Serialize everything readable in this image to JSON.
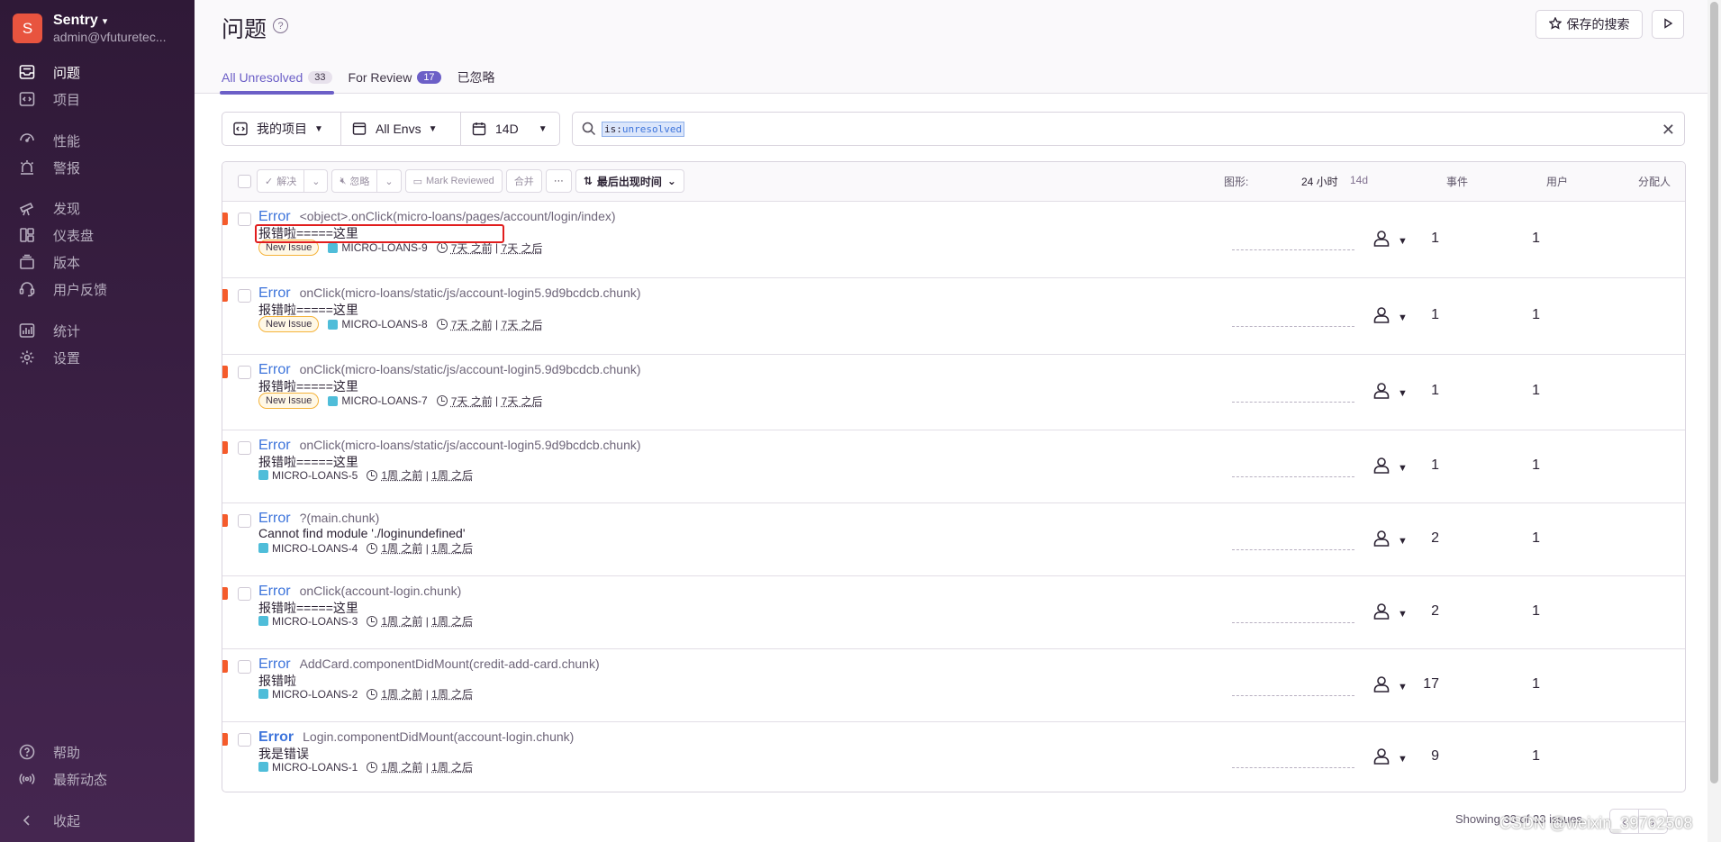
{
  "sidebar": {
    "org_initial": "S",
    "org_name": "Sentry",
    "org_email": "admin@vfuturetec...",
    "items": [
      {
        "label": "问题",
        "icon": "inbox-icon",
        "active": true
      },
      {
        "label": "项目",
        "icon": "code-icon"
      },
      {
        "label": "性能",
        "icon": "lightning-icon"
      },
      {
        "label": "警报",
        "icon": "siren-icon"
      },
      {
        "label": "发现",
        "icon": "telescope-icon"
      },
      {
        "label": "仪表盘",
        "icon": "dashboard-icon"
      },
      {
        "label": "版本",
        "icon": "releases-icon"
      },
      {
        "label": "用户反馈",
        "icon": "support-icon"
      },
      {
        "label": "统计",
        "icon": "stats-icon"
      },
      {
        "label": "设置",
        "icon": "settings-icon"
      }
    ],
    "bottom": [
      {
        "label": "帮助",
        "icon": "question-icon"
      },
      {
        "label": "最新动态",
        "icon": "broadcast-icon"
      },
      {
        "label": "收起",
        "icon": "collapse-icon"
      }
    ]
  },
  "header": {
    "title": "问题",
    "saved_search_label": "保存的搜索"
  },
  "tabs": [
    {
      "label": "All Unresolved",
      "count": "33",
      "active": true
    },
    {
      "label": "For Review",
      "count": "17"
    },
    {
      "label": "已忽略",
      "count": null
    }
  ],
  "filters": {
    "project": "我的项目",
    "env": "All Envs",
    "period": "14D"
  },
  "search": {
    "token_key": "is:",
    "token_value": "unresolved"
  },
  "toolbar": {
    "resolve": "解决",
    "ignore": "忽略",
    "mark_reviewed": "Mark Reviewed",
    "merge": "合并",
    "more": "···",
    "sort": "最后出现时间"
  },
  "columns": {
    "graph": "图形:",
    "period_24h": "24 小时",
    "period_14d": "14d",
    "events": "事件",
    "users": "用户",
    "assignee": "分配人"
  },
  "issues": [
    {
      "type": "Error",
      "location": "<object>.onClick(micro-loans/pages/account/login/index)",
      "message": "报错啦=====这里",
      "new": true,
      "project": "MICRO-LOANS-9",
      "first": "7天 之前",
      "last": "7天 之后",
      "events": "1",
      "users": "1"
    },
    {
      "type": "Error",
      "location": "onClick(micro-loans/static/js/account-login5.9d9bcdcb.chunk)",
      "message": "报错啦=====这里",
      "new": true,
      "project": "MICRO-LOANS-8",
      "first": "7天 之前",
      "last": "7天 之后",
      "events": "1",
      "users": "1"
    },
    {
      "type": "Error",
      "location": "onClick(micro-loans/static/js/account-login5.9d9bcdcb.chunk)",
      "message": "报错啦=====这里",
      "new": true,
      "project": "MICRO-LOANS-7",
      "first": "7天 之前",
      "last": "7天 之后",
      "events": "1",
      "users": "1"
    },
    {
      "type": "Error",
      "location": "onClick(micro-loans/static/js/account-login5.9d9bcdcb.chunk)",
      "message": "报错啦=====这里",
      "new": false,
      "project": "MICRO-LOANS-5",
      "first": "1周 之前",
      "last": "1周 之后",
      "events": "1",
      "users": "1"
    },
    {
      "type": "Error",
      "location": "?(main.chunk)",
      "message": "Cannot find module './loginundefined'",
      "new": false,
      "project": "MICRO-LOANS-4",
      "first": "1周 之前",
      "last": "1周 之后",
      "events": "2",
      "users": "1"
    },
    {
      "type": "Error",
      "location": "onClick(account-login.chunk)",
      "message": "报错啦=====这里",
      "new": false,
      "project": "MICRO-LOANS-3",
      "first": "1周 之前",
      "last": "1周 之后",
      "events": "2",
      "users": "1"
    },
    {
      "type": "Error",
      "location": "AddCard.componentDidMount(credit-add-card.chunk)",
      "message": "报错啦",
      "new": false,
      "project": "MICRO-LOANS-2",
      "first": "1周 之前",
      "last": "1周 之后",
      "events": "17",
      "users": "1"
    },
    {
      "type": "Error",
      "location": "Login.componentDidMount(account-login.chunk)",
      "message": "我是错误",
      "new": false,
      "project": "MICRO-LOANS-1",
      "first": "1周 之前",
      "last": "1周 之后",
      "events": "9",
      "users": "1"
    }
  ],
  "new_issue_label": "New Issue",
  "footer": {
    "showing": "Showing 33 of 33 issues"
  },
  "watermark": "CSDN @weixin_39762508",
  "colors": {
    "accent": "#6c5fc7",
    "error_level": "#f55b2b",
    "link": "#3d74db",
    "highlight_box": "#e11d1d"
  }
}
